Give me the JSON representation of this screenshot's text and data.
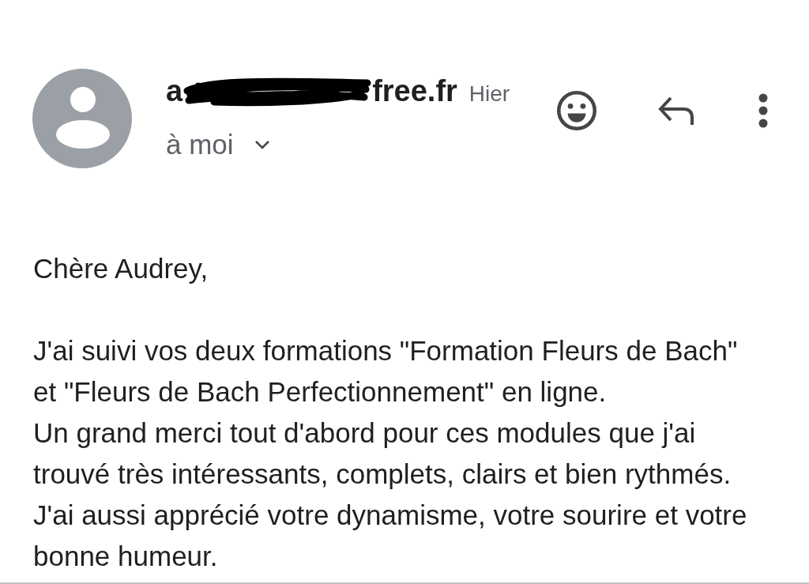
{
  "message_header": {
    "sender": {
      "visible_start": "a",
      "redacted": true,
      "visible_end": "free.fr"
    },
    "date": "Hier",
    "recipient": "à moi",
    "recipient_expanded": false
  },
  "actions": [
    {
      "kind": "emoji"
    },
    {
      "kind": "reply"
    },
    {
      "kind": "more"
    }
  ],
  "body": {
    "greeting": "Chère Audrey,",
    "paragraphs": [
      "J'ai suivi vos deux formations \"Formation Fleurs de Bach\" et \"Fleurs de Bach Perfectionnement\" en ligne.",
      "Un grand merci tout d'abord pour ces modules que j'ai trouvé très intéressants, complets, clairs et bien rythmés.",
      "J'ai aussi apprécié votre dynamisme, votre sourire et votre bonne humeur."
    ]
  }
}
